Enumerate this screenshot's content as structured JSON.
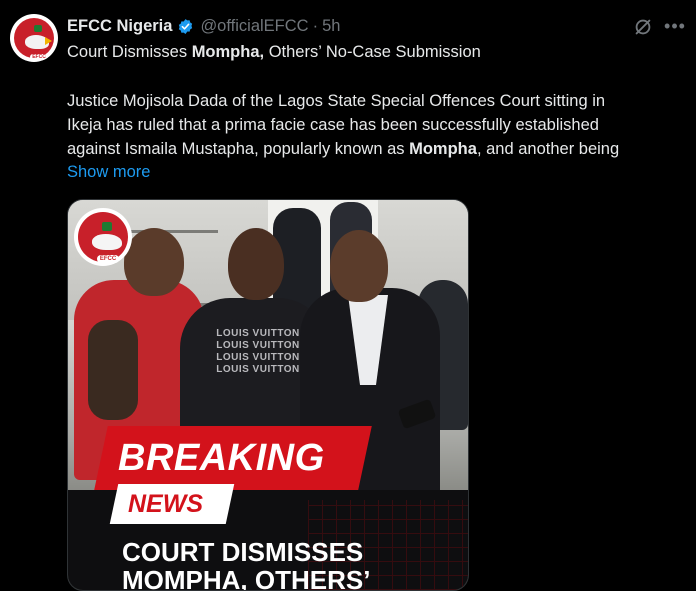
{
  "tweet": {
    "author_name": "EFCC Nigeria",
    "handle": "@officialEFCC",
    "separator": "·",
    "time": "5h",
    "avatar_tag": "EFCC",
    "headline_prefix": "Court Dismisses ",
    "headline_bold": "Mompha,",
    "headline_suffix": " Others’ No-Case Submission",
    "body_line1": "Justice Mojisola Dada of the Lagos State Special Offences Court sitting in",
    "body_line2": "Ikeja has ruled that a prima facie case has been successfully established",
    "body_line3_prefix": "against Ismaila Mustapha, popularly known as ",
    "body_line3_bold": "Mompha",
    "body_line3_suffix": ", and another being",
    "show_more": "Show more"
  },
  "media": {
    "logo_tag": "EFCC",
    "shirt_text": [
      "LOUIS VUITTON",
      "LOUIS VUITTON",
      "LOUIS VUITTON",
      "LOUIS VUITTON"
    ],
    "banner_breaking": "BREAKING",
    "banner_news": "NEWS",
    "headline_line1": "COURT DISMISSES",
    "headline_line2": "MOMPHA, OTHERS’"
  },
  "icons": {
    "verified": "verified-badge-icon",
    "grok": "grok-icon",
    "more": "more-options-icon"
  },
  "colors": {
    "background": "#000000",
    "text": "#e7e9ea",
    "muted": "#71767b",
    "link": "#1d9bf0",
    "verified": "#1d9bf0",
    "breaking_red": "#d3121b"
  }
}
